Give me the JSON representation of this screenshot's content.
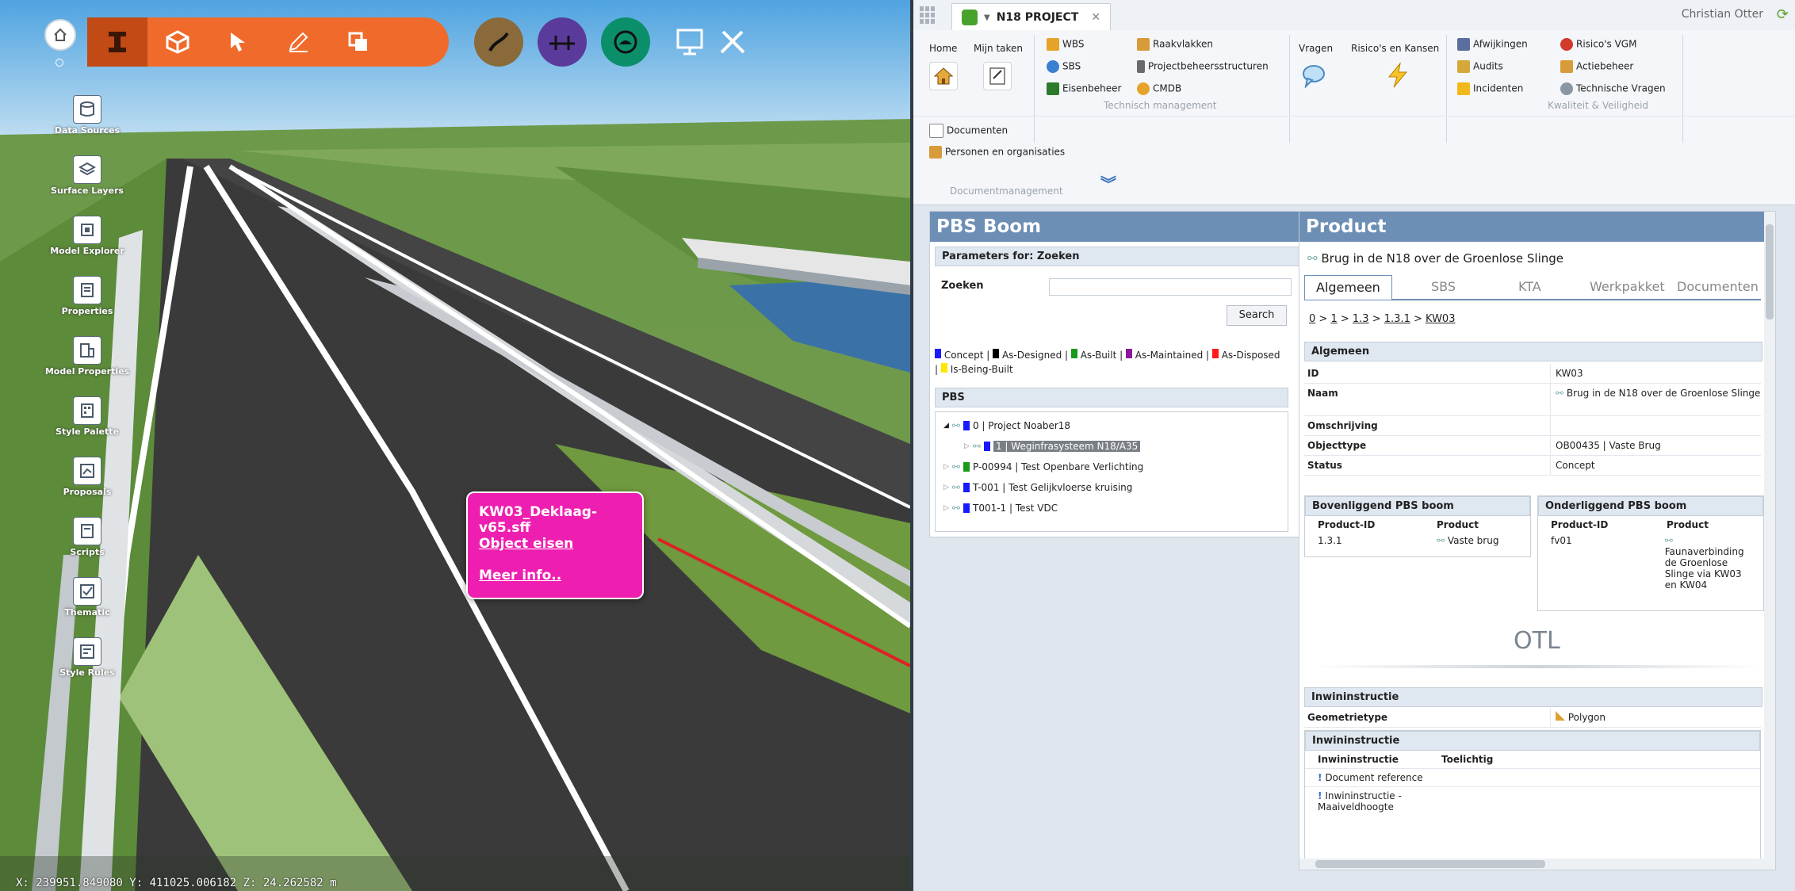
{
  "viewer": {
    "home_label": "",
    "side_tools": [
      {
        "label": "Data Sources",
        "icon": "database-icon"
      },
      {
        "label": "Surface Layers",
        "icon": "layers-icon"
      },
      {
        "label": "Model Explorer",
        "icon": "model-explorer-icon"
      },
      {
        "label": "Properties",
        "icon": "properties-icon"
      },
      {
        "label": "Model Properties",
        "icon": "model-properties-icon"
      },
      {
        "label": "Style Palette",
        "icon": "style-palette-icon"
      },
      {
        "label": "Proposals",
        "icon": "proposals-icon"
      },
      {
        "label": "Scripts",
        "icon": "scripts-icon"
      },
      {
        "label": "Thematic",
        "icon": "thematic-icon"
      },
      {
        "label": "Style Rules",
        "icon": "style-rules-icon"
      }
    ],
    "popup": {
      "title": "KW03_Deklaag-v65.sff",
      "link1": "Object eisen",
      "link2": "Meer info.."
    },
    "coords": "X: 239951.849080  Y: 411025.006182  Z: 24.262582 m",
    "colors": {
      "toolbar": "#f06a2c",
      "popup": "#ee1fb0",
      "green_circle": "#0a8f6a",
      "purple_circle": "#5a3a9a",
      "brown_circle": "#8a6a3a"
    }
  },
  "app": {
    "tab_title": "N18 PROJECT",
    "user": "Christian Otter",
    "ribbon": {
      "home": "Home",
      "mijn_taken": "Mijn taken",
      "wbs": "WBS",
      "sbs": "SBS",
      "eisenbeheer": "Eisenbeheer",
      "raakvlakken": "Raakvlakken",
      "projectbeheer": "Projectbeheersstructuren",
      "cmdb": "CMDB",
      "technisch_mgmt": "Technisch management",
      "vragen": "Vragen",
      "risicos": "Risico's en Kansen",
      "afwijkingen": "Afwijkingen",
      "audits": "Audits",
      "incidenten": "Incidenten",
      "risicos_vgm": "Risico's VGM",
      "actiebeheer": "Actiebeheer",
      "technische_vragen": "Technische Vragen",
      "kwaliteit": "Kwaliteit & Veiligheid",
      "documenten": "Documenten",
      "personen": "Personen en organisaties",
      "documentmgmt": "Documentmanagement"
    },
    "pbs": {
      "title": "PBS Boom",
      "params": "Parameters for: Zoeken",
      "zoeken": "Zoeken",
      "search_btn": "Search",
      "legend": [
        {
          "label": "Concept",
          "color": "#1a1aff"
        },
        {
          "label": "As-Designed",
          "color": "#000000"
        },
        {
          "label": "As-Built",
          "color": "#1a9a1a"
        },
        {
          "label": "As-Maintained",
          "color": "#8a1a9a"
        },
        {
          "label": "As-Disposed",
          "color": "#ff1a1a"
        },
        {
          "label": "Is-Being-Built",
          "color": "#ffe600"
        }
      ],
      "pbs_header": "PBS",
      "tree": [
        "0 | Project Noaber18",
        "1 | Weginfrasysteem N18/A35",
        "P-00994 | Test Openbare Verlichting",
        "T-001 | Test Gelijkvloerse kruising",
        "T001-1 | Test VDC"
      ]
    },
    "product": {
      "title": "Product",
      "name": "Brug in de N18 over de Groenlose Slinge",
      "tabs": [
        "Algemeen",
        "SBS",
        "KTA",
        "Werkpakket",
        "Documenten"
      ],
      "breadcrumb": [
        "0",
        "1",
        "1.3",
        "1.3.1",
        "KW03"
      ],
      "algemeen_header": "Algemeen",
      "fields": [
        {
          "k": "ID",
          "v": "KW03"
        },
        {
          "k": "Naam",
          "v": "Brug in de N18 over de Groenlose Slinge"
        },
        {
          "k": "Omschrijving",
          "v": ""
        },
        {
          "k": "Objecttype",
          "v": "OB00435 | Vaste Brug"
        },
        {
          "k": "Status",
          "v": "Concept"
        }
      ],
      "boven_header": "Bovenliggend PBS boom",
      "onder_header": "Onderliggend PBS boom",
      "col_pid": "Product-ID",
      "col_prod": "Product",
      "boven_row": {
        "pid": "1.3.1",
        "prod": "Vaste brug"
      },
      "onder_row": {
        "pid": "fv01",
        "prod": "Faunaverbinding de Groenlose Slinge via KW03 en KW04"
      },
      "otl": "OTL",
      "inwin_header": "Inwininstructie",
      "geometrietype": "Geometrietype",
      "polygon": "Polygon",
      "inwin_header2": "Inwininstructie",
      "col_inwin": "Inwininstructie",
      "col_toel": "Toelichtig",
      "inwin_rows": [
        "Document reference",
        "Inwininstructie - Maaiveldhoogte"
      ]
    }
  }
}
